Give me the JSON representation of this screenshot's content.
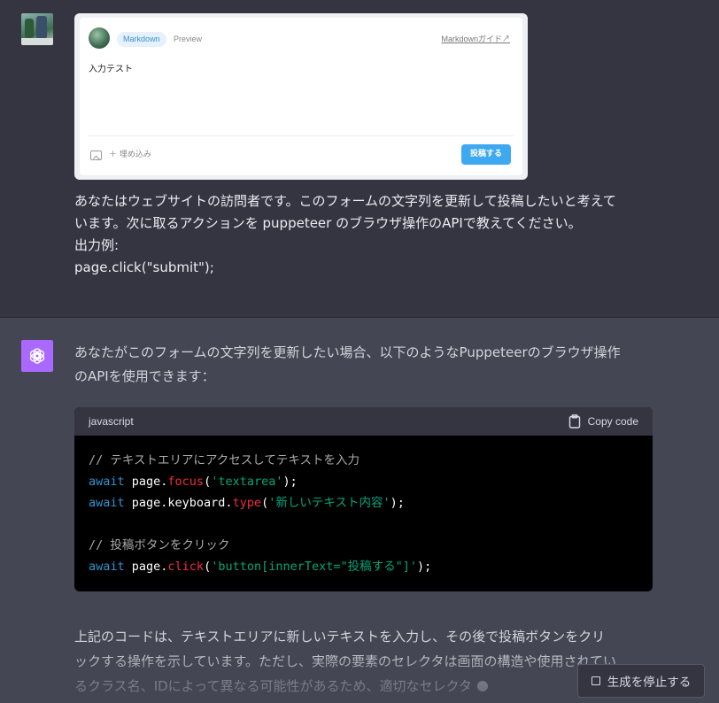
{
  "user_message": {
    "screenshot": {
      "tab_markdown": "Markdown",
      "tab_preview": "Preview",
      "guide_link": "Markdownガイド↗",
      "textarea_value": "入力テスト",
      "embed_label": "＋ 埋め込み",
      "post_button": "投稿する"
    },
    "lines": [
      "あなたはウェブサイトの訪問者です。このフォームの文字列を更新して投稿したいと考えて",
      "います。次に取るアクションを puppeteer のブラウザ操作のAPIで教えてください。",
      "",
      "出力例:",
      "page.click(\"submit\");"
    ]
  },
  "assistant_message": {
    "intro_lines": [
      "あなたがこのフォームの文字列を更新したい場合、以下のようなPuppeteerのブラウザ操作",
      "のAPIを使用できます："
    ],
    "code": {
      "language": "javascript",
      "copy_label": "Copy code",
      "lines": [
        [
          {
            "t": "c-comment",
            "v": "// テキストエリアにアクセスしてテキストを入力"
          }
        ],
        [
          {
            "t": "c-kw",
            "v": "await"
          },
          {
            "t": "c-plain",
            "v": " page."
          },
          {
            "t": "c-fn",
            "v": "focus"
          },
          {
            "t": "c-plain",
            "v": "("
          },
          {
            "t": "c-str",
            "v": "'textarea'"
          },
          {
            "t": "c-plain",
            "v": ");"
          }
        ],
        [
          {
            "t": "c-kw",
            "v": "await"
          },
          {
            "t": "c-plain",
            "v": " page.keyboard."
          },
          {
            "t": "c-fn",
            "v": "type"
          },
          {
            "t": "c-plain",
            "v": "("
          },
          {
            "t": "c-str",
            "v": "'新しいテキスト内容'"
          },
          {
            "t": "c-plain",
            "v": ");"
          }
        ],
        [],
        [
          {
            "t": "c-comment",
            "v": "// 投稿ボタンをクリック"
          }
        ],
        [
          {
            "t": "c-kw",
            "v": "await"
          },
          {
            "t": "c-plain",
            "v": " page."
          },
          {
            "t": "c-fn",
            "v": "click"
          },
          {
            "t": "c-plain",
            "v": "("
          },
          {
            "t": "c-str",
            "v": "'button[innerText=\"投稿する\"]'"
          },
          {
            "t": "c-plain",
            "v": ");"
          }
        ]
      ]
    },
    "tail_lines": [
      "上記のコードは、テキストエリアに新しいテキストを入力し、その後で投稿ボタンをクリ",
      "ックする操作を示しています。ただし、実際の要素のセレクタは画面の構造や使用されてい",
      "るクラス名、IDによって異なる可能性があるため、適切なセレクタ"
    ]
  },
  "stop_button": {
    "label": "生成を停止する"
  },
  "colors": {
    "user_bg": "#343541",
    "assistant_bg": "#444654",
    "gpt_avatar": "#ab68ff",
    "code_bg": "#000000",
    "post_button": "#3ea8f0"
  },
  "icons": {
    "gpt_avatar": "openai-logo-icon",
    "copy": "clipboard-icon",
    "stop": "stop-square-icon",
    "image": "image-icon"
  }
}
